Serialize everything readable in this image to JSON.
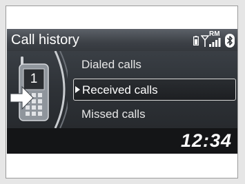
{
  "header": {
    "title": "Call history",
    "roaming_label": "RM",
    "icons": [
      "phone-battery-icon",
      "signal-strength-icon",
      "bluetooth-icon"
    ]
  },
  "phone_graphic": {
    "line_number": "1",
    "icon": "received-call-arrow-icon"
  },
  "menu": {
    "items": [
      {
        "label": "Dialed calls",
        "selected": false
      },
      {
        "label": "Received calls",
        "selected": true
      },
      {
        "label": "Missed calls",
        "selected": false
      }
    ]
  },
  "footer": {
    "time": "12:34"
  }
}
